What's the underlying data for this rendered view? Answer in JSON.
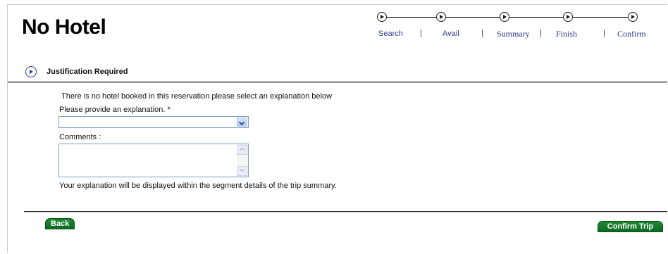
{
  "page": {
    "title": "No Hotel"
  },
  "progress": {
    "steps": [
      {
        "label": "Search"
      },
      {
        "label": "Avail"
      },
      {
        "label": "Summary"
      },
      {
        "label": "Finish"
      },
      {
        "label": "Confirm"
      }
    ],
    "separator": "|"
  },
  "section": {
    "title": "Justification Required"
  },
  "form": {
    "intro": "There is no hotel booked in this reservation please select an explanation below",
    "explanation_label": "Please provide an explanation. *",
    "explanation_selected": "",
    "comments_label": "Comments :",
    "comments_value": "",
    "note": "Your explanation will be displayed within the segment details of the trip summary."
  },
  "actions": {
    "back_label": "Back",
    "confirm_label": "Confirm Trip"
  },
  "colors": {
    "button_green": "#1f8a34",
    "step_label": "#2b3a8f"
  }
}
